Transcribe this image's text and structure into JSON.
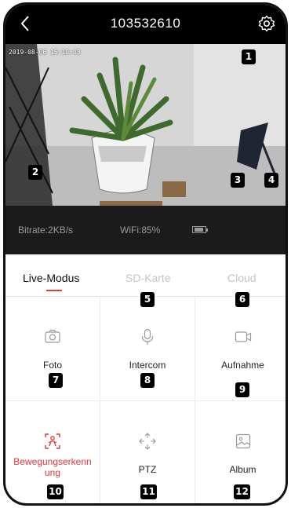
{
  "header": {
    "title": "103532610",
    "back_icon": "chevron-left-icon",
    "settings_icon": "gear-icon"
  },
  "video": {
    "timestamp": "2019-08-06 15:10:43"
  },
  "status": {
    "bitrate": "Bitrate:2KB/s",
    "wifi": "WiFi:85%",
    "battery_icon": "battery-icon"
  },
  "tabs": [
    {
      "label": "Live-Modus",
      "active": true
    },
    {
      "label": "SD-Karte",
      "active": false
    },
    {
      "label": "Cloud",
      "active": false
    }
  ],
  "functions": [
    {
      "label": "Foto",
      "icon": "camera-icon"
    },
    {
      "label": "Intercom",
      "icon": "microphone-icon"
    },
    {
      "label": "Aufnahme",
      "icon": "video-record-icon"
    },
    {
      "label_line1": "Bewegungserkenn",
      "label_line2": "ung",
      "icon": "motion-detection-icon"
    },
    {
      "label": "PTZ",
      "icon": "ptz-arrows-icon"
    },
    {
      "label": "Album",
      "icon": "album-icon"
    }
  ],
  "markers": [
    "1",
    "2",
    "3",
    "4",
    "5",
    "6",
    "7",
    "8",
    "9",
    "10",
    "11",
    "12"
  ],
  "colors": {
    "accent": "#e03a3a",
    "header_bg": "#000000",
    "status_bg": "#1b1b1b"
  }
}
